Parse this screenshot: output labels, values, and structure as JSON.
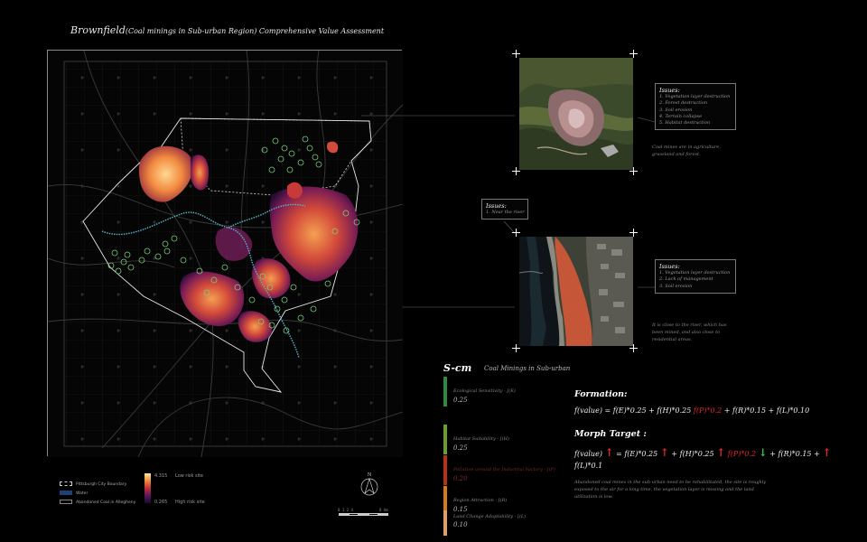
{
  "title": {
    "main": "Brownfield",
    "sub": "(Coal minings in Sub-urban Region) Comprehensive Value Assessment"
  },
  "colors": {
    "background": "#000000",
    "low_risk": "#ffe6a0",
    "high_risk": "#1a0a2c",
    "red_text": "#e0282e",
    "green_arrow": "#3fc33f",
    "factor_green": "#2e8b3e",
    "factor_lime": "#6aa02a",
    "factor_red": "#b83218",
    "factor_orange": "#d57a18",
    "factor_tan": "#e0a060"
  },
  "legend": {
    "items": [
      {
        "label": "Pittsburgh City Boundary",
        "icon": "dashed-line"
      },
      {
        "label": "Water",
        "icon": "blue-fill"
      },
      {
        "label": "Abandoned Coal in Allegheny",
        "icon": "outline-box"
      }
    ],
    "gradient": {
      "high_value": "4.315",
      "high_label": "Low risk site",
      "low_value": "0.265",
      "low_label": "High risk site"
    }
  },
  "scale": {
    "ticks": "0 1 2   4",
    "unit": "8  km"
  },
  "north": {
    "label": "N"
  },
  "sites": [
    {
      "issues_title": "Issues:",
      "issues": [
        "1. Vegetation layer destruction",
        "2. Forest destruction",
        "3. Soil erosion",
        "4. Terrain collapse",
        "5. Habitat destruction"
      ],
      "note": "Coal mines are in agriculture, grassland and forest."
    },
    {
      "issues_title": "Issues:",
      "issues": [
        "1. Vegetation layer destruction",
        "2. Lack of management",
        "3. Soil erosion"
      ],
      "note": "It is close to the river, which has been mined, and also close to residential areas.",
      "extra_issues_title": "Issues:",
      "extra_issues": [
        "1. Near the river"
      ]
    }
  ],
  "scm": {
    "title": "S-cm",
    "subtitle": "Coal Minings in Sub-urban",
    "factors": [
      {
        "label": "Ecological Sensitivity - [(E)",
        "value": "0.25",
        "color": "#2e8b3e"
      },
      {
        "label": "Habitat Suitability - [(H)",
        "value": "0.25",
        "color": "#6aa02a"
      },
      {
        "label": "Pollution around the Industrial Factory - [(P)",
        "value": "0.20",
        "color": "#b83218"
      },
      {
        "label": "Region Attraction - [(R)",
        "value": "0.15",
        "color": "#d57a18"
      },
      {
        "label": "Land Change Adaptability - [(L)",
        "value": "0.10",
        "color": "#e0a060"
      }
    ]
  },
  "formation": {
    "heading": "Formation:",
    "formula_a": "f(value) = f(E)*0.25 + f(H)*0.25",
    "formula_p": "f(P)*0.2",
    "formula_b": "+ f(R)*0.15 + f(L)*0.10"
  },
  "morph": {
    "heading": "Morph Target :",
    "t1": "f(value)",
    "t2": "= f(E)*0.25",
    "t3": "+ f(H)*0.25",
    "t4": "f(P)*0.2",
    "t5": "+ f(R)*0.15 +",
    "t6": "f(L)*0.1",
    "up": "↑",
    "down": "↓"
  },
  "description": "Abandoned coal mines in the sub-urban need to be rehabilitated, the site is roughly exposed to the air for a long time, the vegetation layer is missing and the land utilization is low."
}
